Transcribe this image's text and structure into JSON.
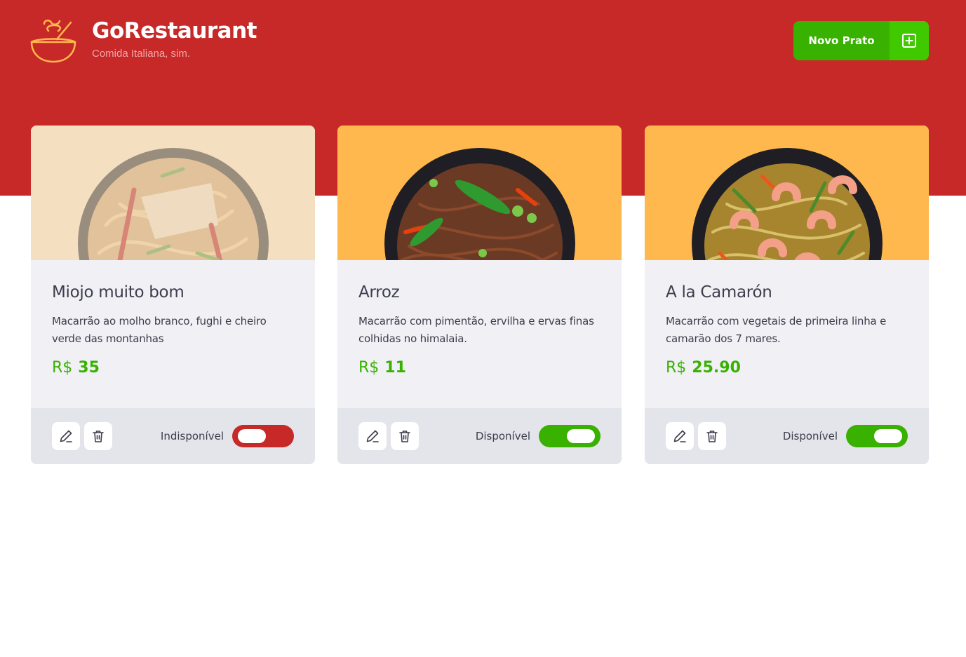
{
  "header": {
    "title": "GoRestaurant",
    "subtitle": "Comida Italiana, sim.",
    "new_button_label": "Novo Prato",
    "logo_icon": "soup-bowl-icon",
    "add_icon": "plus-square-icon"
  },
  "colors": {
    "brand_red": "#c72828",
    "accent_green": "#39b100",
    "card_image_bg_available": "#ffb84d",
    "card_image_bg_unavailable": "#f5dfc1"
  },
  "foods": [
    {
      "name": "Miojo muito bom",
      "description": "Macarrão ao molho branco, fughi e cheiro verde das montanhas",
      "currency": "R$",
      "price": "35",
      "status_label": "Indisponível",
      "available": false
    },
    {
      "name": "Arroz",
      "description": "Macarrão com pimentão, ervilha e ervas finas colhidas no himalaia.",
      "currency": "R$",
      "price": "11",
      "status_label": "Disponível",
      "available": true
    },
    {
      "name": "A la Camarón",
      "description": "Macarrão com vegetais de primeira linha e camarão dos 7 mares.",
      "currency": "R$",
      "price": "25.90",
      "status_label": "Disponível",
      "available": true
    }
  ]
}
